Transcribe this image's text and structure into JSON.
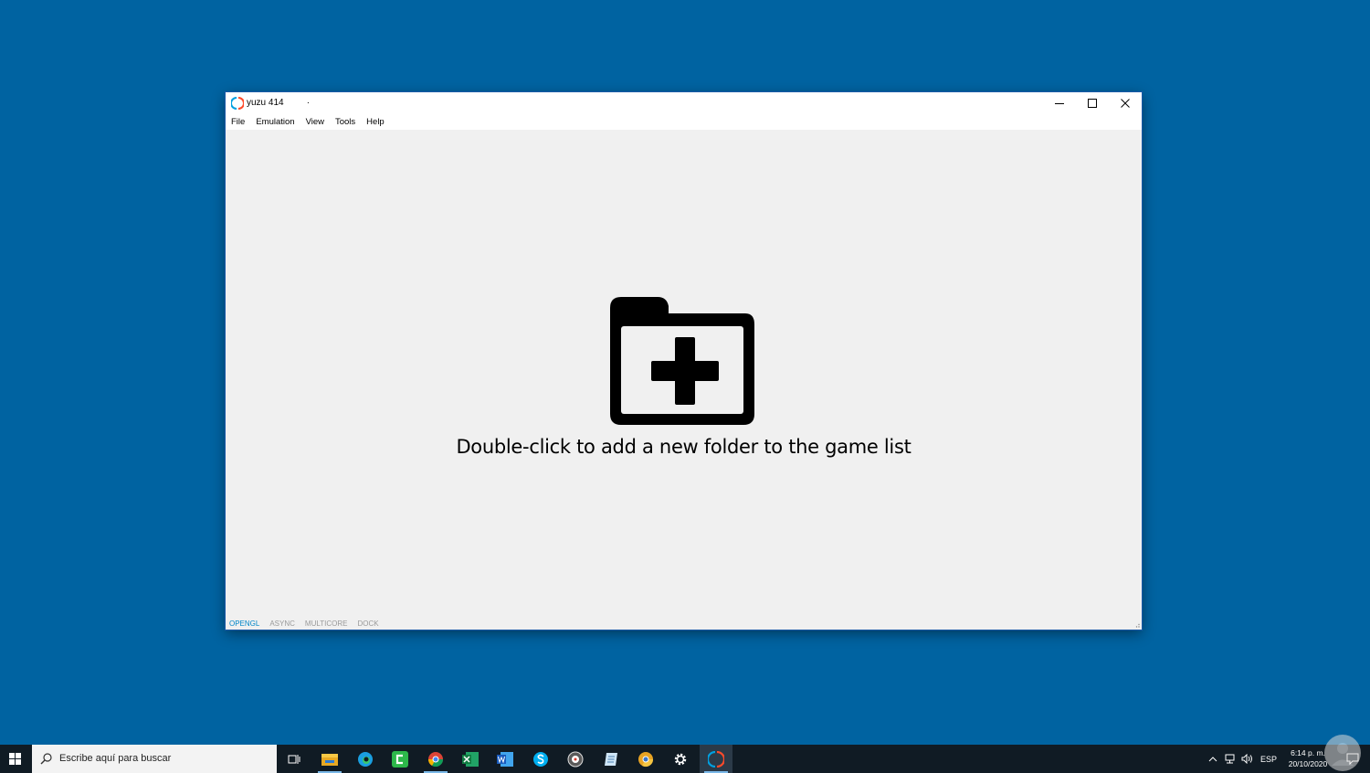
{
  "window": {
    "title": "yuzu 414",
    "title_suffix": ".",
    "menu": [
      "File",
      "Emulation",
      "View",
      "Tools",
      "Help"
    ],
    "hint": "Double-click to add a new folder to the game list",
    "status": [
      {
        "label": "OPENGL",
        "active": true
      },
      {
        "label": "ASYNC",
        "active": false
      },
      {
        "label": "MULTICORE",
        "active": false
      },
      {
        "label": "DOCK",
        "active": false
      }
    ]
  },
  "taskbar": {
    "search_placeholder": "Escribe aquí para buscar",
    "apps": [
      {
        "icon": "task-view-icon"
      },
      {
        "icon": "file-explorer-icon",
        "running": true
      },
      {
        "icon": "edge-icon"
      },
      {
        "icon": "camtasia-icon"
      },
      {
        "icon": "chrome-icon",
        "running": true
      },
      {
        "icon": "excel-icon"
      },
      {
        "icon": "word-icon"
      },
      {
        "icon": "skype-icon"
      },
      {
        "icon": "media-app-icon"
      },
      {
        "icon": "notepad-icon"
      },
      {
        "icon": "chrome-canary-icon"
      },
      {
        "icon": "settings-icon"
      },
      {
        "icon": "yuzu-icon",
        "running": true,
        "selected": true
      }
    ],
    "language": "ESP",
    "time": "6:14 p. m.",
    "date": "20/10/2020"
  },
  "colors": {
    "desktop": "#0063a1",
    "taskbar": "#101b24",
    "status_active": "#0086c8",
    "status_inactive": "#9a9a9a"
  }
}
